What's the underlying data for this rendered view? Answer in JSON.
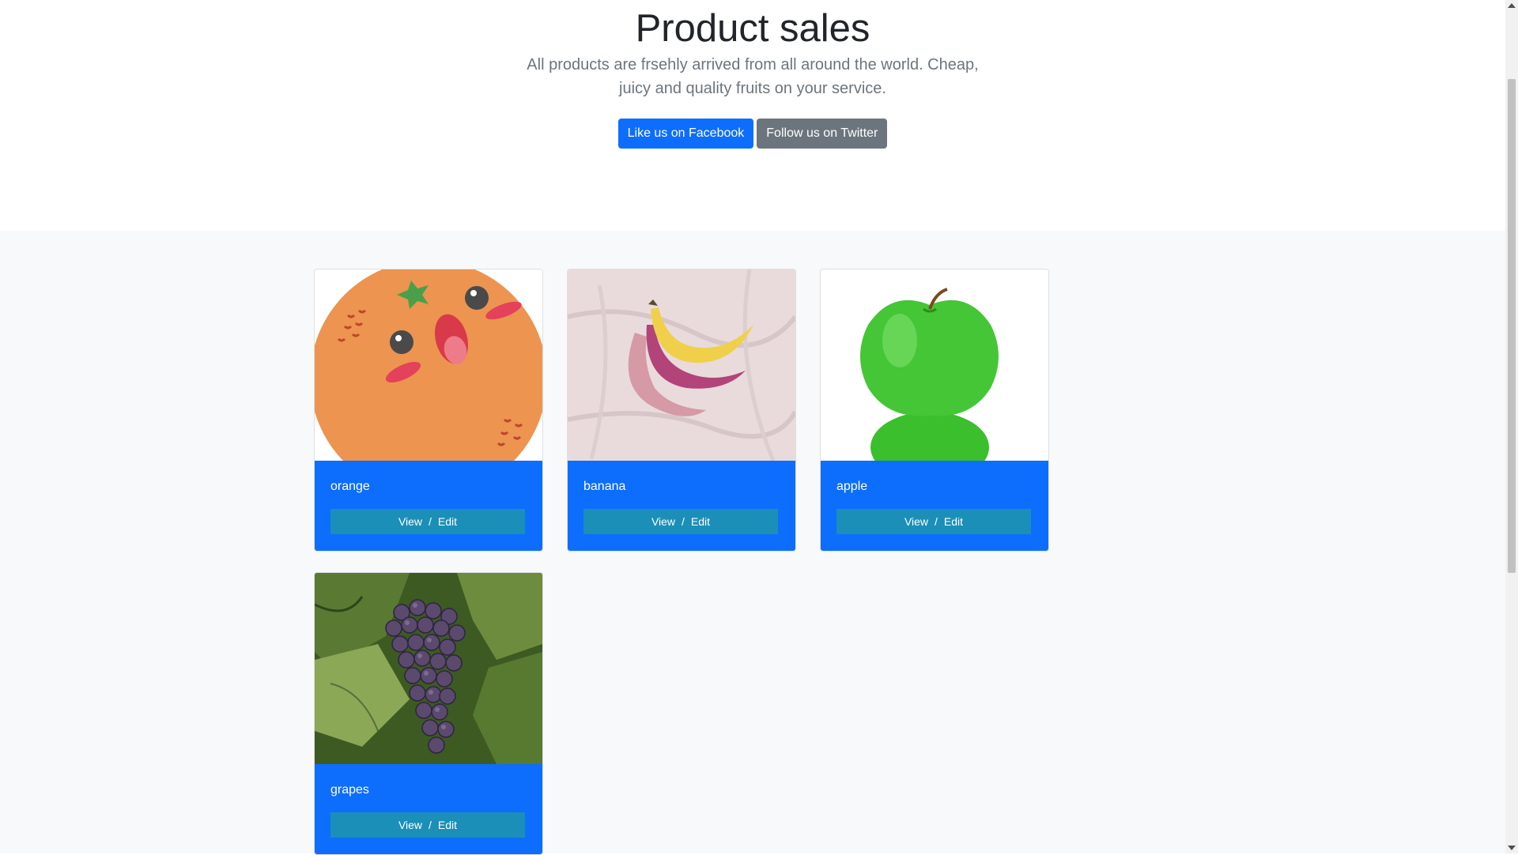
{
  "hero": {
    "title": "Product sales",
    "lead": "All products are frsehly arrived from all around the world. Cheap, juicy and quality fruits on your service.",
    "facebook_label": "Like us on Facebook",
    "twitter_label": "Follow us on Twitter"
  },
  "products": [
    {
      "name": "orange",
      "view_label": "View",
      "separator": "/",
      "edit_label": "Edit"
    },
    {
      "name": "banana",
      "view_label": "View",
      "separator": "/",
      "edit_label": "Edit"
    },
    {
      "name": "apple",
      "view_label": "View",
      "separator": "/",
      "edit_label": "Edit"
    },
    {
      "name": "grapes",
      "view_label": "View",
      "separator": "/",
      "edit_label": "Edit"
    }
  ],
  "colors": {
    "primary": "#0d6efd",
    "secondary": "#6c757d",
    "action_bar": "#1b8fb8",
    "album_bg": "#f8f9fa"
  }
}
